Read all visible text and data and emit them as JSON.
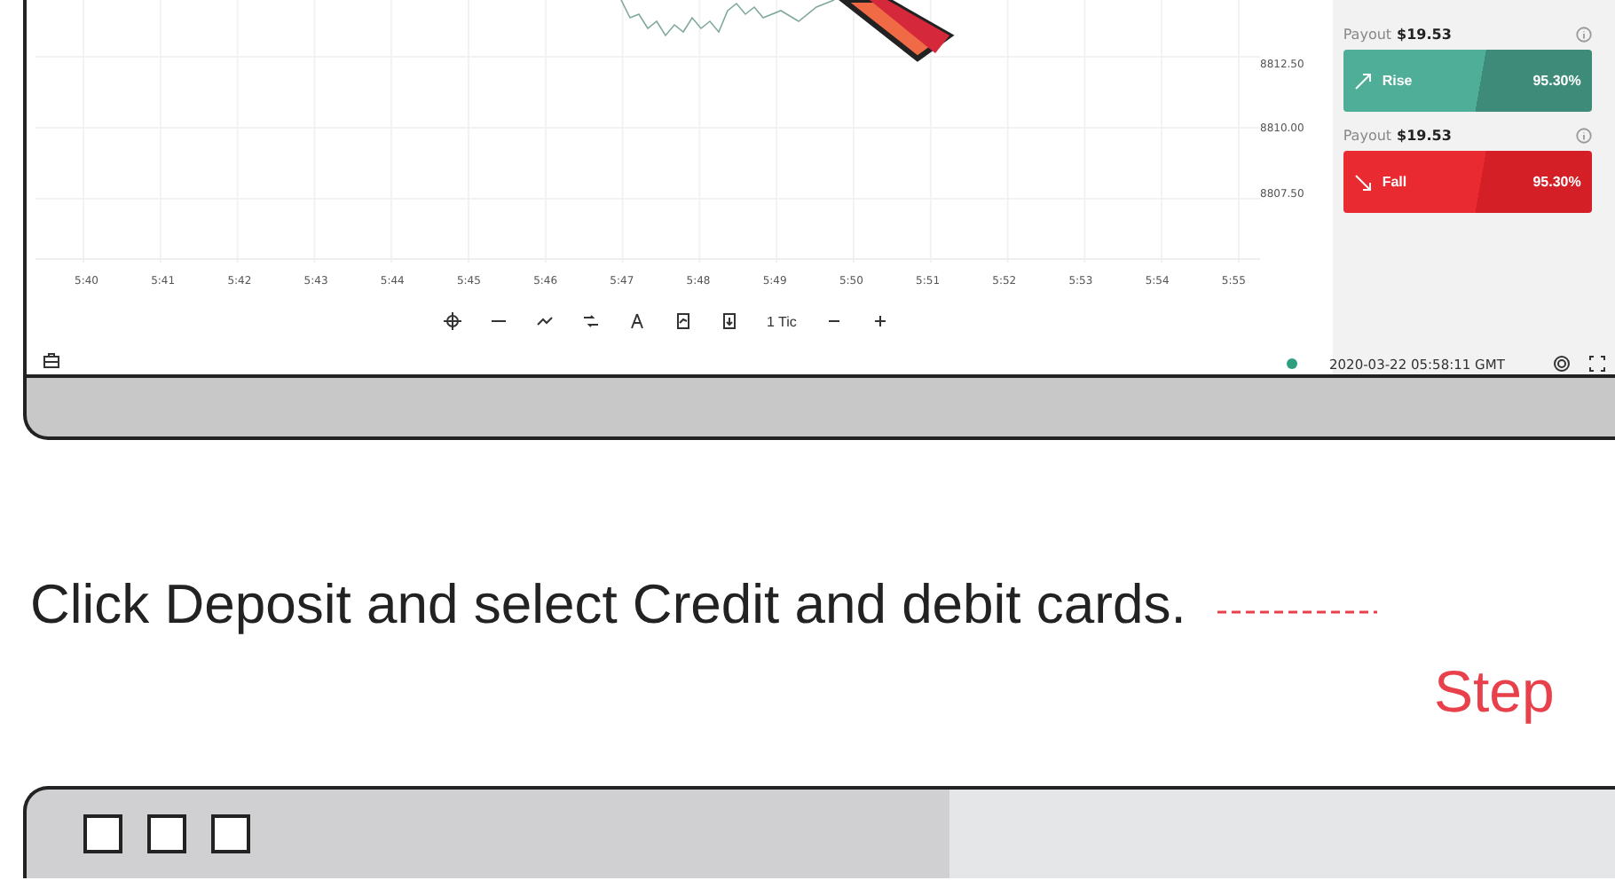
{
  "chart": {
    "y_labels": [
      "8812.50",
      "8810.00",
      "8807.50"
    ],
    "x_labels": [
      "5:40",
      "5:41",
      "5:42",
      "5:43",
      "5:44",
      "5:45",
      "5:46",
      "5:47",
      "5:48",
      "5:49",
      "5:50",
      "5:51",
      "5:52",
      "5:53",
      "5:54",
      "5:55"
    ]
  },
  "toolbar": {
    "interval": "1 Tic"
  },
  "trade_options": [
    {
      "kind": "rise",
      "payout_label": "Payout",
      "payout": "$19.53",
      "label": "Rise",
      "percent": "95.30%"
    },
    {
      "kind": "fall",
      "payout_label": "Payout",
      "payout": "$19.53",
      "label": "Fall",
      "percent": "95.30%"
    }
  ],
  "status_bar": {
    "connected": true,
    "timestamp": "2020-03-22 05:58:11 GMT"
  },
  "instruction": "Click Deposit and select Credit and debit cards.",
  "step_label": "Step"
}
